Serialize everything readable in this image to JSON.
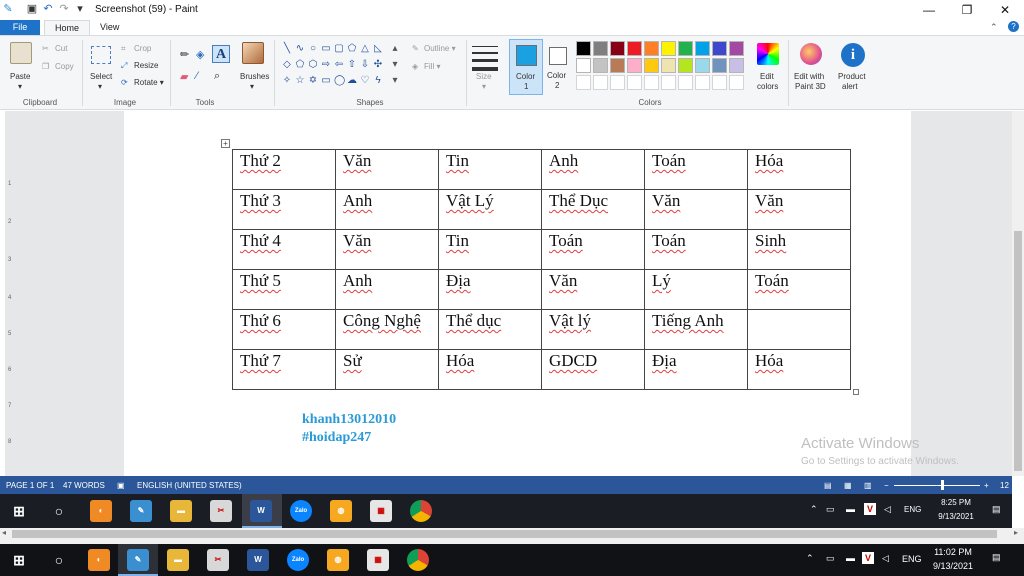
{
  "window": {
    "title": "Screenshot (59) - Paint",
    "minimize": "—",
    "maximize": "❐",
    "close": "✕"
  },
  "tabs": {
    "file": "File",
    "home": "Home",
    "view": "View"
  },
  "ribbon": {
    "clipboard": {
      "paste": "Paste",
      "cut": "Cut",
      "copy": "Copy",
      "label": "Clipboard"
    },
    "image": {
      "select": "Select",
      "crop": "Crop",
      "resize": "Resize",
      "rotate": "Rotate ▾",
      "label": "Image"
    },
    "tools": {
      "label": "Tools"
    },
    "brushes": {
      "label": "Brushes"
    },
    "shapes": {
      "outline": "Outline ▾",
      "fill": "Fill ▾",
      "label": "Shapes"
    },
    "size": {
      "label": "Size"
    },
    "color1": {
      "label": "Color",
      "num": "1",
      "value": "#1ba1e2"
    },
    "color2": {
      "label": "Color",
      "num": "2",
      "value": "#ffffff"
    },
    "colors_label": "Colors",
    "edit_colors": [
      "Edit",
      "colors"
    ],
    "paint3d": [
      "Edit with",
      "Paint 3D"
    ],
    "product_alert": [
      "Product",
      "alert"
    ],
    "palette_row1": [
      "#000000",
      "#7f7f7f",
      "#880015",
      "#ed1c24",
      "#ff7f27",
      "#fff200",
      "#22b14c",
      "#00a2e8",
      "#3f48cc",
      "#a349a4"
    ],
    "palette_row2": [
      "#ffffff",
      "#c3c3c3",
      "#b97a57",
      "#ffaec9",
      "#ffc90e",
      "#efe4b0",
      "#b5e61d",
      "#99d9ea",
      "#7092be",
      "#c8bfe7"
    ]
  },
  "timetable": [
    [
      "Thứ 2",
      "Văn",
      "Tin",
      "Anh",
      "Toán",
      "Hóa"
    ],
    [
      "Thứ 3",
      "Anh",
      "Vật Lý",
      "Thể Dục",
      "Văn",
      "Văn"
    ],
    [
      "Thứ 4",
      "Văn",
      "Tin",
      "Toán",
      "Toán",
      "Sinh"
    ],
    [
      "Thứ 5",
      "Anh",
      "Địa",
      "Văn",
      "Lý",
      "Toán"
    ],
    [
      "Thứ 6",
      "Công Nghệ",
      "Thể dục",
      "Vật lý",
      "Tiếng Anh",
      ""
    ],
    [
      "Thứ 7",
      "Sử",
      "Hóa",
      "GDCD",
      "Địa",
      "Hóa"
    ]
  ],
  "watermark": {
    "line1": "khanh13012010",
    "line2": "#hoidap247"
  },
  "activate": {
    "title": "Activate Windows",
    "sub": "Go to Settings to activate Windows."
  },
  "word_status": {
    "page": "PAGE 1 OF 1",
    "words": "47 WORDS",
    "lang": "ENGLISH (UNITED STATES)",
    "zoom": "12"
  },
  "inner_taskbar": {
    "time": "8:25 PM",
    "date": "9/13/2021",
    "lang": "ENG"
  },
  "outer_taskbar": {
    "time": "11:02 PM",
    "date": "9/13/2021",
    "lang": "ENG"
  }
}
